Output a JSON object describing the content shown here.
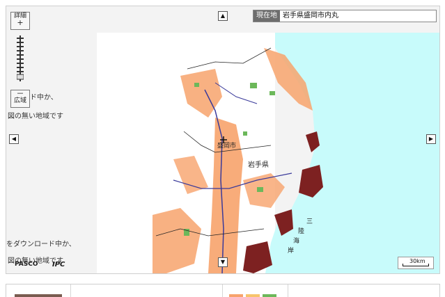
{
  "zoom": {
    "in_label": "詳細",
    "in_sign": "+",
    "out_label": "広域",
    "out_sign": "－"
  },
  "location": {
    "label": "現在地",
    "value": "岩手県盛岡市内丸"
  },
  "map_labels": {
    "city": "盛岡市",
    "prefecture": "岩手県",
    "coast": [
      "三",
      "陸",
      "海",
      "岸"
    ]
  },
  "status_messages": [
    "ロード中か、",
    "図の無い地域です",
    "をダウンロード中か、",
    "図の無い地域です"
  ],
  "credits": {
    "pasco": "PASCO",
    "ipc": "IPC"
  },
  "scale": "30km",
  "colors": {
    "sea": "#c8fbfb",
    "land": "#ffffff",
    "outside": "#f3f3f3",
    "lowland": "#f7a36c",
    "forest": "#6cb85a",
    "tsunami": "#7d2121",
    "road": "#3a3a9a"
  },
  "legend": {
    "swatches": [
      "#7a5c50",
      "#f7a36c",
      "#f7c46c",
      "#6cb85a"
    ]
  }
}
